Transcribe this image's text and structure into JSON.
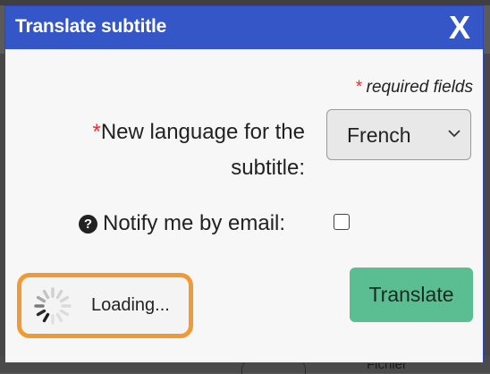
{
  "dialog": {
    "title": "Translate subtitle",
    "close_label": "X"
  },
  "form": {
    "required_star": "*",
    "required_note": "required fields",
    "language_star": "*",
    "language_label_line1": "New language for the",
    "language_label_line2": "subtitle:",
    "language_selected": "French",
    "notify_label": "Notify me by email:",
    "notify_checked": false,
    "translate_label": "Translate"
  },
  "status": {
    "loading_text": "Loading..."
  },
  "background": {
    "partial_word": "Fichier"
  },
  "colors": {
    "titlebar": "#3456c6",
    "translate_button": "#5bbd92",
    "loading_highlight": "#ef9a36",
    "required_star": "#d33333"
  },
  "icons": {
    "help": "question-circle-icon",
    "dropdown": "chevron-down-icon",
    "spinner": "loading-spinner-icon"
  }
}
